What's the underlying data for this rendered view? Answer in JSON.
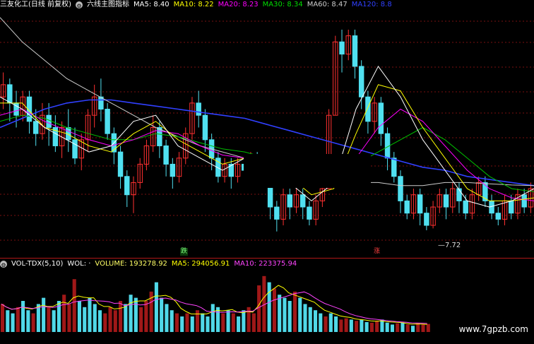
{
  "main_legend": {
    "stock_name": "三友化工(日线 前复权)",
    "indicator_name": "六线主图指标",
    "items": [
      {
        "label": "MA5: 8.40",
        "color": "#ffffff"
      },
      {
        "label": "MA10: 8.22",
        "color": "#ffff00"
      },
      {
        "label": "MA20: 8.23",
        "color": "#ff00ff"
      },
      {
        "label": "MA30: 8.34",
        "color": "#00dd00"
      },
      {
        "label": "MA60: 8.47",
        "color": "#cccccc"
      },
      {
        "label": "MA120: 8.8",
        "color": "#3040ff"
      }
    ]
  },
  "volume_legend": {
    "indicator": "VOL-TDX(5,10)",
    "vol_label": "WOL: ·",
    "items": [
      {
        "label": "VOLUME: 193278.92",
        "color": "#ffff66"
      },
      {
        "label": "MA5: 294056.91",
        "color": "#ffff00"
      },
      {
        "label": "MA10: 223375.94",
        "color": "#ff44ff"
      }
    ]
  },
  "markers": {
    "low_price": "7.72",
    "die_tag": "跌",
    "zhang_tag": "涨"
  },
  "watermark": "www.7gpzb.com",
  "colors": {
    "up": "#ff3030",
    "down": "#50e0f0",
    "ma120": "#3040ff",
    "ma60": "#cccccc",
    "ma30": "#00c000",
    "ma20": "#ff00ff",
    "ma10": "#ffff00",
    "ma5": "#ffffff",
    "grid": "#7a1010"
  },
  "chart_data": {
    "type": "candlestick",
    "price_min": 7.5,
    "price_max": 11.3,
    "candles": [
      {
        "o": 9.9,
        "c": 10.1,
        "h": 10.3,
        "l": 9.7
      },
      {
        "o": 10.1,
        "c": 9.8,
        "h": 10.2,
        "l": 9.5
      },
      {
        "o": 9.8,
        "c": 9.6,
        "h": 10.0,
        "l": 9.4
      },
      {
        "o": 9.6,
        "c": 9.9,
        "h": 10.0,
        "l": 9.5
      },
      {
        "o": 9.9,
        "c": 9.5,
        "h": 10.0,
        "l": 9.3
      },
      {
        "o": 9.5,
        "c": 9.3,
        "h": 9.7,
        "l": 9.1
      },
      {
        "o": 9.3,
        "c": 9.6,
        "h": 9.8,
        "l": 9.2
      },
      {
        "o": 9.6,
        "c": 9.4,
        "h": 9.8,
        "l": 9.1
      },
      {
        "o": 9.4,
        "c": 9.1,
        "h": 9.6,
        "l": 9.0
      },
      {
        "o": 9.1,
        "c": 9.4,
        "h": 9.5,
        "l": 8.9
      },
      {
        "o": 9.4,
        "c": 9.2,
        "h": 9.7,
        "l": 9.0
      },
      {
        "o": 9.2,
        "c": 8.9,
        "h": 9.4,
        "l": 8.8
      },
      {
        "o": 8.9,
        "c": 9.2,
        "h": 9.3,
        "l": 8.7
      },
      {
        "o": 9.2,
        "c": 9.6,
        "h": 9.7,
        "l": 9.0
      },
      {
        "o": 9.6,
        "c": 9.9,
        "h": 10.1,
        "l": 9.4
      },
      {
        "o": 9.9,
        "c": 9.7,
        "h": 10.2,
        "l": 9.5
      },
      {
        "o": 9.7,
        "c": 9.3,
        "h": 9.8,
        "l": 9.2
      },
      {
        "o": 9.3,
        "c": 9.0,
        "h": 9.4,
        "l": 8.8
      },
      {
        "o": 9.0,
        "c": 8.6,
        "h": 9.1,
        "l": 8.4
      },
      {
        "o": 8.6,
        "c": 8.3,
        "h": 8.7,
        "l": 8.1
      },
      {
        "o": 8.3,
        "c": 8.5,
        "h": 8.6,
        "l": 8.0
      },
      {
        "o": 8.5,
        "c": 8.8,
        "h": 8.9,
        "l": 8.4
      },
      {
        "o": 8.8,
        "c": 9.1,
        "h": 9.2,
        "l": 8.7
      },
      {
        "o": 9.1,
        "c": 9.4,
        "h": 9.6,
        "l": 9.0
      },
      {
        "o": 9.4,
        "c": 9.1,
        "h": 9.5,
        "l": 8.9
      },
      {
        "o": 9.1,
        "c": 8.8,
        "h": 9.2,
        "l": 8.6
      },
      {
        "o": 8.8,
        "c": 8.6,
        "h": 8.9,
        "l": 8.4
      },
      {
        "o": 8.6,
        "c": 8.9,
        "h": 9.0,
        "l": 8.5
      },
      {
        "o": 8.9,
        "c": 9.3,
        "h": 9.4,
        "l": 8.8
      },
      {
        "o": 9.3,
        "c": 9.8,
        "h": 9.9,
        "l": 9.2
      },
      {
        "o": 9.8,
        "c": 9.6,
        "h": 10.0,
        "l": 9.4
      },
      {
        "o": 9.6,
        "c": 9.2,
        "h": 9.7,
        "l": 9.0
      },
      {
        "o": 9.2,
        "c": 8.9,
        "h": 9.3,
        "l": 8.7
      },
      {
        "o": 8.9,
        "c": 8.6,
        "h": 9.0,
        "l": 8.5
      },
      {
        "o": 8.6,
        "c": 8.8,
        "h": 8.9,
        "l": 8.5
      },
      {
        "o": 8.8,
        "c": 8.6,
        "h": 8.9,
        "l": 8.4
      },
      {
        "o": 8.6,
        "c": 8.8,
        "h": 8.9,
        "l": 8.5
      },
      {
        "o": 8.8,
        "c": 8.7,
        "h": 8.9,
        "l": 8.5
      },
      {
        "o": 8.7,
        "c": 8.9,
        "h": 9.0,
        "l": 8.6
      },
      {
        "o": 8.9,
        "c": 8.7,
        "h": 9.0,
        "l": 8.5
      },
      {
        "o": 8.7,
        "c": 8.6,
        "h": 8.8,
        "l": 8.5
      },
      {
        "o": 8.6,
        "c": 8.1,
        "h": 8.6,
        "l": 7.9
      },
      {
        "o": 8.1,
        "c": 7.9,
        "h": 8.2,
        "l": 7.7
      },
      {
        "o": 7.9,
        "c": 8.3,
        "h": 8.4,
        "l": 7.8
      },
      {
        "o": 8.3,
        "c": 8.1,
        "h": 8.4,
        "l": 7.9
      },
      {
        "o": 8.1,
        "c": 8.3,
        "h": 8.4,
        "l": 8.0
      },
      {
        "o": 8.3,
        "c": 8.1,
        "h": 8.4,
        "l": 7.9
      },
      {
        "o": 8.1,
        "c": 7.9,
        "h": 8.2,
        "l": 7.8
      },
      {
        "o": 7.9,
        "c": 8.2,
        "h": 8.3,
        "l": 7.8
      },
      {
        "o": 8.2,
        "c": 8.4,
        "h": 8.5,
        "l": 8.1
      },
      {
        "o": 8.4,
        "c": 9.6,
        "h": 9.7,
        "l": 8.4
      },
      {
        "o": 9.6,
        "c": 10.8,
        "h": 10.9,
        "l": 9.6
      },
      {
        "o": 10.8,
        "c": 10.6,
        "h": 11.0,
        "l": 10.3
      },
      {
        "o": 10.6,
        "c": 10.9,
        "h": 11.0,
        "l": 10.5
      },
      {
        "o": 10.9,
        "c": 10.4,
        "h": 11.0,
        "l": 10.2
      },
      {
        "o": 10.4,
        "c": 9.9,
        "h": 10.5,
        "l": 9.7
      },
      {
        "o": 9.9,
        "c": 9.5,
        "h": 10.0,
        "l": 9.3
      },
      {
        "o": 9.5,
        "c": 9.8,
        "h": 9.9,
        "l": 9.3
      },
      {
        "o": 9.8,
        "c": 9.3,
        "h": 9.9,
        "l": 9.1
      },
      {
        "o": 9.3,
        "c": 8.9,
        "h": 9.4,
        "l": 8.7
      },
      {
        "o": 8.9,
        "c": 8.6,
        "h": 9.0,
        "l": 8.5
      },
      {
        "o": 8.6,
        "c": 8.2,
        "h": 8.7,
        "l": 8.0
      },
      {
        "o": 8.2,
        "c": 8.0,
        "h": 8.3,
        "l": 7.9
      },
      {
        "o": 8.0,
        "c": 8.3,
        "h": 8.4,
        "l": 7.9
      },
      {
        "o": 8.3,
        "c": 8.0,
        "h": 8.4,
        "l": 7.8
      },
      {
        "o": 8.0,
        "c": 7.8,
        "h": 8.1,
        "l": 7.72
      },
      {
        "o": 7.8,
        "c": 8.1,
        "h": 8.2,
        "l": 7.75
      },
      {
        "o": 8.1,
        "c": 8.3,
        "h": 8.4,
        "l": 8.0
      },
      {
        "o": 8.3,
        "c": 8.1,
        "h": 8.4,
        "l": 7.9
      },
      {
        "o": 8.1,
        "c": 8.4,
        "h": 8.5,
        "l": 8.0
      },
      {
        "o": 8.4,
        "c": 8.2,
        "h": 8.5,
        "l": 8.0
      },
      {
        "o": 8.2,
        "c": 8.0,
        "h": 8.3,
        "l": 7.9
      },
      {
        "o": 8.0,
        "c": 8.3,
        "h": 8.4,
        "l": 7.9
      },
      {
        "o": 8.3,
        "c": 8.5,
        "h": 8.6,
        "l": 8.2
      },
      {
        "o": 8.5,
        "c": 8.2,
        "h": 8.6,
        "l": 8.1
      },
      {
        "o": 8.2,
        "c": 8.0,
        "h": 8.3,
        "l": 7.9
      },
      {
        "o": 8.0,
        "c": 7.9,
        "h": 8.1,
        "l": 7.8
      },
      {
        "o": 7.9,
        "c": 8.2,
        "h": 8.3,
        "l": 7.8
      },
      {
        "o": 8.2,
        "c": 8.0,
        "h": 8.3,
        "l": 7.9
      },
      {
        "o": 8.0,
        "c": 8.3,
        "h": 8.4,
        "l": 7.9
      },
      {
        "o": 8.3,
        "c": 8.1,
        "h": 8.4,
        "l": 8.0
      },
      {
        "o": 8.1,
        "c": 8.4,
        "h": 8.5,
        "l": 8.0
      }
    ],
    "volumes": [
      0.45,
      0.35,
      0.3,
      0.4,
      0.5,
      0.35,
      0.3,
      0.45,
      0.55,
      0.4,
      0.35,
      0.5,
      0.6,
      0.45,
      0.85,
      0.5,
      0.4,
      0.55,
      0.45,
      0.35,
      0.3,
      0.4,
      0.35,
      0.5,
      0.45,
      0.6,
      0.55,
      0.4,
      0.5,
      0.65,
      0.8,
      0.55,
      0.45,
      0.35,
      0.3,
      0.25,
      0.3,
      0.25,
      0.35,
      0.3,
      0.25,
      0.45,
      0.4,
      0.3,
      0.35,
      0.3,
      0.25,
      0.35,
      0.4,
      0.3,
      0.75,
      0.9,
      0.8,
      0.7,
      0.6,
      0.55,
      0.5,
      0.65,
      0.55,
      0.45,
      0.4,
      0.35,
      0.3,
      0.25,
      0.3,
      0.25,
      0.2,
      0.22,
      0.2,
      0.18,
      0.2,
      0.16,
      0.15,
      0.18,
      0.2,
      0.15,
      0.12,
      0.14,
      0.15,
      0.12,
      0.1,
      0.14,
      0.12,
      0.13
    ],
    "ma120": [
      9.4,
      9.55,
      9.7,
      9.8,
      9.85,
      9.85,
      9.8,
      9.75,
      9.7,
      9.65,
      9.6,
      9.55,
      9.45,
      9.35,
      9.25,
      9.15,
      9.05,
      8.95,
      8.85,
      8.75,
      8.7,
      8.6,
      8.55,
      8.5,
      8.45
    ],
    "ma60": [
      11.2,
      10.8,
      10.5,
      10.2,
      10.0,
      9.8,
      9.6,
      9.4,
      9.25,
      9.1,
      9.0,
      8.9,
      8.8,
      8.7,
      8.6,
      8.55,
      8.5,
      8.5,
      8.45,
      8.45,
      8.5,
      8.5,
      8.48,
      8.46,
      8.45
    ],
    "ma30": [
      9.5,
      9.6,
      9.55,
      9.4,
      9.3,
      9.2,
      9.2,
      9.3,
      9.25,
      9.15,
      9.05,
      9.0,
      8.9,
      8.8,
      8.7,
      8.65,
      8.8,
      9.0,
      9.2,
      9.4,
      9.2,
      8.9,
      8.6,
      8.4,
      8.35
    ],
    "ma20": [
      9.6,
      9.7,
      9.5,
      9.35,
      9.2,
      9.1,
      9.2,
      9.35,
      9.3,
      9.1,
      8.95,
      8.9,
      8.8,
      8.7,
      8.55,
      8.5,
      8.9,
      9.4,
      9.7,
      9.5,
      9.1,
      8.7,
      8.4,
      8.25,
      8.2
    ],
    "ma10": [
      9.8,
      9.8,
      9.4,
      9.3,
      9.1,
      9.0,
      9.3,
      9.5,
      9.2,
      9.0,
      8.8,
      8.9,
      8.8,
      8.6,
      8.3,
      8.4,
      9.3,
      10.1,
      10.0,
      9.4,
      8.9,
      8.4,
      8.2,
      8.2,
      8.25
    ],
    "ma5": [
      9.9,
      9.7,
      9.4,
      9.2,
      9.0,
      9.1,
      9.5,
      9.6,
      9.1,
      8.9,
      8.7,
      8.9,
      8.8,
      8.5,
      8.2,
      8.5,
      9.7,
      10.4,
      9.9,
      9.2,
      8.7,
      8.2,
      8.1,
      8.2,
      8.4
    ]
  }
}
